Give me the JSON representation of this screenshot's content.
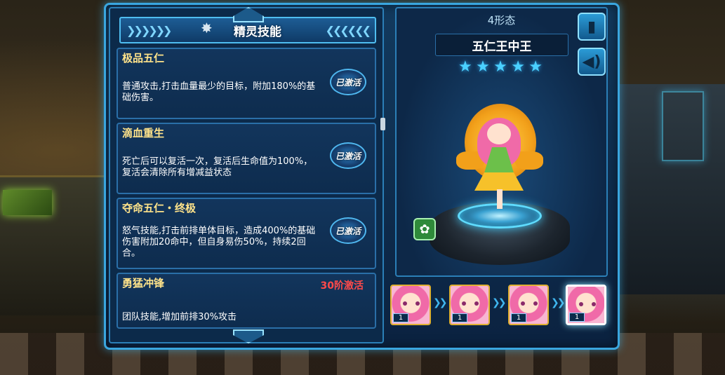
{
  "header": {
    "title": "精灵技能"
  },
  "skills": [
    {
      "name": "极品五仁",
      "desc": "普通攻击,打击血量最少的目标，附加180%的基础伤害。",
      "status": "已激活"
    },
    {
      "name": "滴血重生",
      "desc": "死亡后可以复活一次，复活后生命值为100%，复活会清除所有增减益状态",
      "status": "已激活"
    },
    {
      "name": "夺命五仁・终极",
      "desc": "怒气技能,打击前排单体目标，造成400%的基础伤害附加20命中，但自身易伤50%，持续2回合。",
      "status": "已激活"
    },
    {
      "name": "勇猛冲锋",
      "desc": "团队技能,增加前排30%攻击",
      "status": "30阶激活"
    }
  ],
  "character": {
    "form_count": "4形态",
    "name": "五仁王中王",
    "stars": 5,
    "star_icon": "★",
    "element_icon": "leaf-icon"
  },
  "forms": [
    {
      "level": "1"
    },
    {
      "level": "1"
    },
    {
      "level": "1"
    },
    {
      "level": "1"
    }
  ],
  "side_buttons": {
    "info_icon": "exclamation-icon",
    "sound_icon": "speaker-icon"
  },
  "colors": {
    "skill_name": "#ffe38a",
    "locked": "#ff4a4a",
    "star": "#4ad0ff",
    "frame": "#3aa6df"
  }
}
